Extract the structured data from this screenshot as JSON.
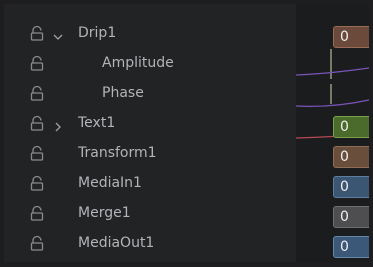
{
  "rows": [
    {
      "label": "Drip1",
      "expander": "expanded",
      "value": "0"
    },
    {
      "label": "Amplitude",
      "expander": "none"
    },
    {
      "label": "Phase",
      "expander": "none"
    },
    {
      "label": "Text1",
      "expander": "collapsed",
      "value": "0"
    },
    {
      "label": "Transform1",
      "expander": "none",
      "value": "0"
    },
    {
      "label": "MediaIn1",
      "expander": "none",
      "value": "0"
    },
    {
      "label": "Merge1",
      "expander": "none",
      "value": "0"
    },
    {
      "label": "MediaOut1",
      "expander": "none",
      "value": "0"
    }
  ],
  "colors": {
    "drip": "#6b4a3b",
    "text": "#4b6b2c",
    "transform": "#6a4e3c",
    "media_in": "#3a5673",
    "merge": "#4e4e50",
    "media_out": "#3c5878",
    "curve_purple": "#7a55b8",
    "curve_red": "#b84a55"
  },
  "icons": {
    "lock": "lock-icon",
    "expanded": "chevron-down-icon",
    "collapsed": "chevron-right-icon"
  }
}
